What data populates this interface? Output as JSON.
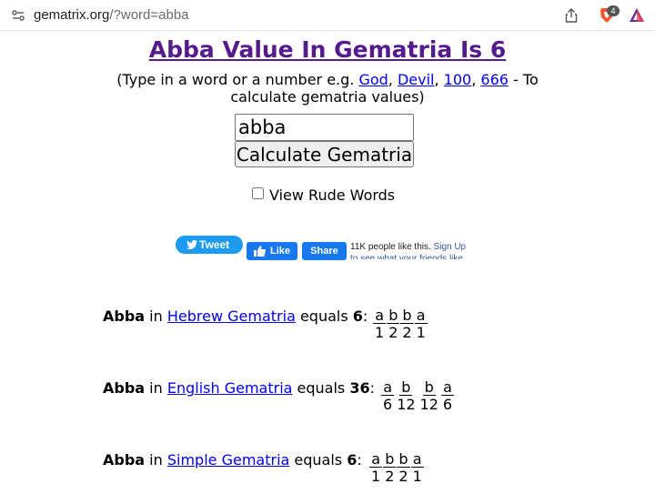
{
  "browser": {
    "url_domain": "gematrix.org",
    "url_path": "/?word=abba",
    "brave_shield_count": "4",
    "icons": [
      "site-info-icon",
      "share-icon",
      "brave-shields-icon",
      "brave-rewards-icon"
    ]
  },
  "page": {
    "title": "Abba Value In Gematria Is 6",
    "intro": {
      "prefix": "(Type in a word or a number e.g. ",
      "links": [
        "God",
        "Devil",
        "100",
        "666"
      ],
      "sep": ", ",
      "suffix": " - To calculate gematria values)"
    },
    "search": {
      "value": "abba",
      "button_label": "Calculate Gematria"
    },
    "rude_words_label": "View Rude Words",
    "rude_words_checked": false
  },
  "social": {
    "tweet_label": "Tweet",
    "like_label": "Like",
    "share_label": "Share",
    "likes_text": "11K people like this. ",
    "signup_text": "Sign Up to see what your friends like."
  },
  "results": [
    {
      "word": "Abba",
      "in": " in ",
      "system": "Hebrew Gematria",
      "equals": " equals ",
      "value": "6",
      "colon": ":",
      "letters": [
        {
          "ch": "a",
          "val": "1"
        },
        {
          "ch": "b",
          "val": "2"
        },
        {
          "ch": "b",
          "val": "2"
        },
        {
          "ch": "a",
          "val": "1"
        }
      ]
    },
    {
      "word": "Abba",
      "in": " in ",
      "system": "English Gematria",
      "equals": " equals ",
      "value": "36",
      "colon": ":",
      "letters": [
        {
          "ch": "a",
          "val": "6"
        },
        {
          "ch": "b",
          "val": "12"
        },
        {
          "ch": "b",
          "val": "12"
        },
        {
          "ch": "a",
          "val": "6"
        }
      ]
    },
    {
      "word": "Abba",
      "in": " in ",
      "system": "Simple Gematria",
      "equals": " equals ",
      "value": "6",
      "colon": ":",
      "letters": [
        {
          "ch": "a",
          "val": "1"
        },
        {
          "ch": "b",
          "val": "2"
        },
        {
          "ch": "b",
          "val": "2"
        },
        {
          "ch": "a",
          "val": "1"
        }
      ]
    }
  ],
  "colors": {
    "title": "#551a8b",
    "link": "#0000ee",
    "twitter": "#1d9bf0",
    "facebook": "#1877f2"
  }
}
